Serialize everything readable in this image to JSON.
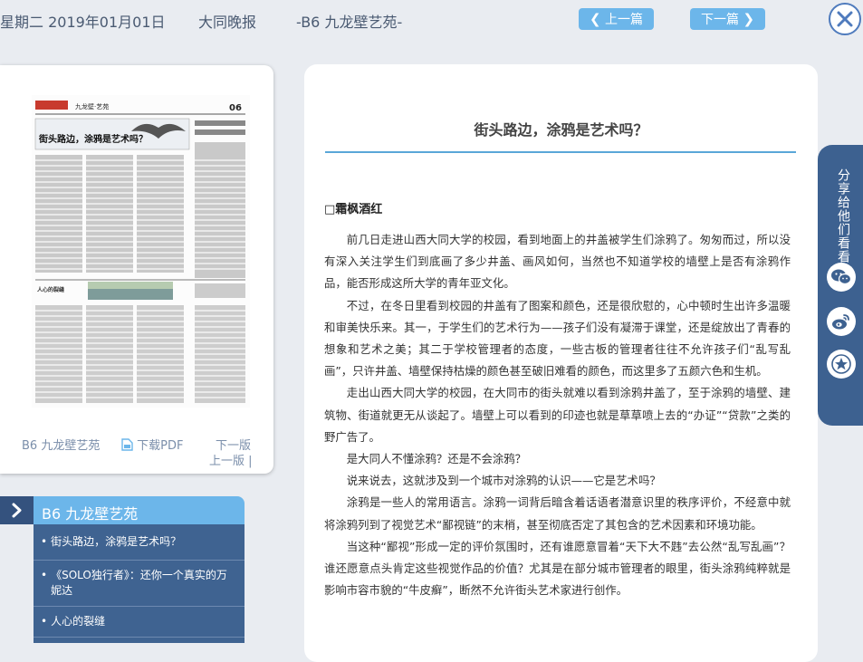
{
  "header": {
    "date": "星期二 2019年01月01日",
    "paper_name": "大同晚报",
    "page_label": "-B6 九龙壁艺苑-",
    "prev_label": "上一篇",
    "next_label": "下一篇",
    "close_icon": "close-icon"
  },
  "thumbnail": {
    "page_name": "B6 九龙壁艺苑",
    "download_label": "下载PDF",
    "next_page_label": "下一版",
    "prev_page_label": "上一版 |",
    "page_number": "06",
    "headline": "街头路边，涂鸦是艺术吗？",
    "section_mark": "九龙壁·艺苑",
    "sub_label": "人心的裂缝"
  },
  "section": {
    "title": "B6 九龙壁艺苑",
    "items": [
      "街头路边，涂鸦是艺术吗？",
      "《SOLO独行者》：还你一个真实的万妮达",
      "人心的裂缝"
    ]
  },
  "article": {
    "title": "街头路边，涂鸦是艺术吗？",
    "author": "□霜枫酒红",
    "paragraphs": [
      "前几日走进山西大同大学的校园，看到地面上的井盖被学生们涂鸦了。匆匆而过，所以没有深入关注学生们到底画了多少井盖、画风如何，当然也不知道学校的墙壁上是否有涂鸦作品，能否形成这所大学的青年亚文化。",
      "不过，在冬日里看到校园的井盖有了图案和颜色，还是很欣慰的，心中顿时生出许多温暖和审美快乐来。其一，于学生们的艺术行为——孩子们没有凝滞于课堂，还是绽放出了青春的想象和艺术之美；其二于学校管理者的态度，一些古板的管理者往往不允许孩子们“乱写乱画”，只许井盖、墙壁保持枯燥的颜色甚至破旧难看的颜色，而这里多了五颜六色和生机。",
      "走出山西大同大学的校园，在大同市的街头就难以看到涂鸦井盖了，至于涂鸦的墙壁、建筑物、街道就更无从谈起了。墙壁上可以看到的印迹也就是草草喷上去的“办证”“贷款”之类的野广告了。",
      "是大同人不懂涂鸦？还是不会涂鸦？",
      "说来说去，这就涉及到一个城市对涂鸦的认识——它是艺术吗？",
      "涂鸦是一些人的常用语言。涂鸦一词背后暗含着话语者潜意识里的秩序评价，不经意中就将涂鸦列到了视觉艺术“鄙视链”的末梢，甚至彻底否定了其包含的艺术因素和环境功能。",
      "当这种“鄙视”形成一定的评价氛围时，还有谁愿意冒着“天下大不韪”去公然“乱写乱画”？谁还愿意点头肯定这些视觉作品的价值？尤其是在部分城市管理者的眼里，街头涂鸦纯粹就是影响市容市貌的“牛皮癣”，断然不允许街头艺术家进行创作。"
    ]
  },
  "share": {
    "label": "分享给他们看看",
    "icons": [
      "wechat-icon",
      "weibo-icon",
      "favorite-star-icon"
    ]
  }
}
